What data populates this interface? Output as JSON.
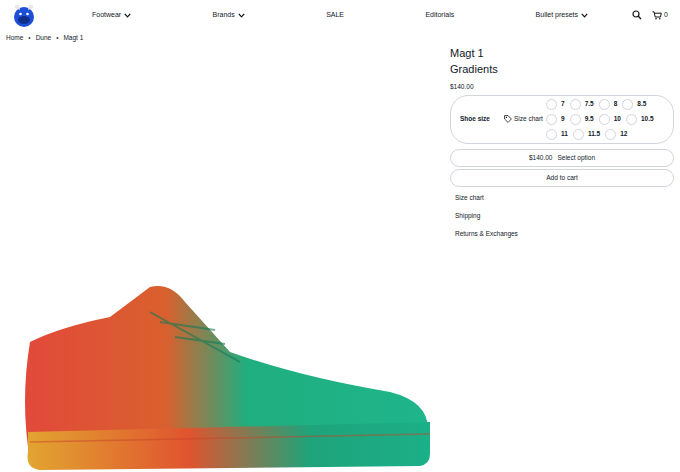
{
  "nav": [
    {
      "label": "Footwear",
      "dropdown": true
    },
    {
      "label": "Brands",
      "dropdown": true
    },
    {
      "label": "SALE",
      "dropdown": false
    },
    {
      "label": "Editorials",
      "dropdown": false
    },
    {
      "label": "Bullet presets",
      "dropdown": true
    }
  ],
  "cart": {
    "count": "0"
  },
  "breadcrumb": {
    "separator": "•",
    "items": [
      "Home",
      "Dune",
      "Magt 1"
    ]
  },
  "product": {
    "title": "Magt 1",
    "subtitle": "Gradients",
    "price": "$140.00"
  },
  "size_picker": {
    "label": "Shoe size",
    "chart_link": "Size chart",
    "options": [
      {
        "label": "7",
        "selected": false
      },
      {
        "label": "7.5",
        "selected": false
      },
      {
        "label": "8",
        "selected": false
      },
      {
        "label": "8.5",
        "selected": false
      },
      {
        "label": "9",
        "selected": false
      },
      {
        "label": "9.5",
        "selected": false
      },
      {
        "label": "10",
        "selected": false
      },
      {
        "label": "10.5",
        "selected": false
      },
      {
        "label": "11",
        "selected": false
      },
      {
        "label": "11.5",
        "selected": false
      },
      {
        "label": "12",
        "selected": false
      }
    ]
  },
  "select_button": {
    "price": "$140.00",
    "label": "Select option"
  },
  "cart_button": {
    "label": "Add to cart"
  },
  "info_links": [
    "Size chart",
    "Shipping",
    "Returns & Exchanges"
  ]
}
